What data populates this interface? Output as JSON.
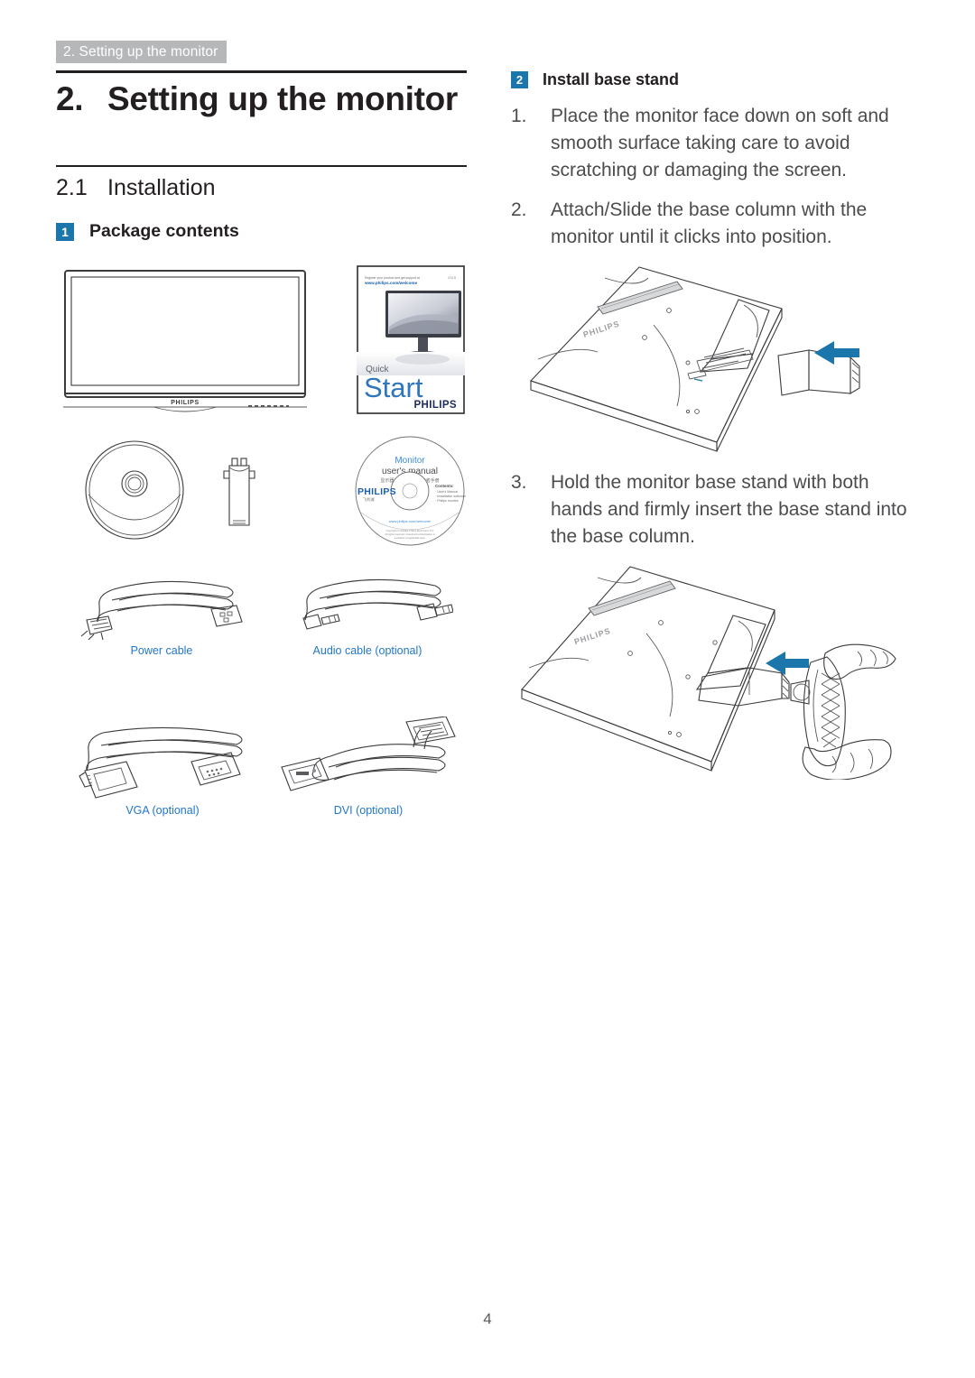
{
  "header": {
    "running_title": "2. Setting up the monitor",
    "tab_bg": "#b6b7b9"
  },
  "chapter": {
    "number": "2.",
    "title": "Setting up the monitor"
  },
  "section": {
    "number": "2.1",
    "title": "Installation"
  },
  "left_column": {
    "subsection": {
      "badge": "1",
      "label": "Package contents"
    },
    "items": [
      {
        "name": "monitor",
        "caption": ""
      },
      {
        "name": "quick-start-guide",
        "caption": ""
      },
      {
        "name": "base-disc",
        "caption": ""
      },
      {
        "name": "base-column",
        "caption": ""
      },
      {
        "name": "cd-rom",
        "caption": ""
      },
      {
        "name": "power-cable",
        "caption": "Power cable"
      },
      {
        "name": "audio-cable",
        "caption": "Audio cable (optional)"
      },
      {
        "name": "vga-cable",
        "caption": "VGA (optional)"
      },
      {
        "name": "dvi-cable",
        "caption": "DVI (optional)"
      }
    ],
    "monitor_logo": "PHILIPS",
    "quick_start": {
      "small_line_1": "Register your product and get support at",
      "small_line_2": "www.philips.com/welcome",
      "corner_code": "231S",
      "word_quick": "Quick",
      "word_start": "Start",
      "brand": "PHILIPS"
    },
    "cd": {
      "line_1": "Monitor",
      "line_2": "user's manual",
      "line_3": "显示器 用户手册 / 使用者手册",
      "brand": "PHILIPS",
      "brand_sub": "飞利浦",
      "contents_title": "Contents:",
      "contents": [
        "User's Manual",
        "Installation software",
        "Philips monitor"
      ],
      "url": "www.philips.com/welcome"
    },
    "caption_color": "#2277c8"
  },
  "right_column": {
    "subsection": {
      "badge": "2",
      "label": "Install base stand"
    },
    "steps": [
      {
        "number": "1.",
        "text": "Place the monitor face down on soft and smooth surface taking care to avoid scratching or damaging the screen."
      },
      {
        "number": "2.",
        "text": "Attach/Slide the base column with the monitor until it clicks into position."
      },
      {
        "number": "3.",
        "text": "Hold the monitor base stand with both hands and firmly insert the base stand into the base column."
      }
    ],
    "figures": [
      {
        "name": "figure-attach-base-column",
        "arrow": "left-arrow",
        "arrow_color": "#1b76ab",
        "back_logo": "PHILIPS"
      },
      {
        "name": "figure-insert-base-stand",
        "arrow": "left-arrow",
        "arrow_color": "#1b76ab",
        "back_logo": "PHILIPS"
      }
    ]
  },
  "footer": {
    "page_number": "4"
  },
  "colors": {
    "badge_blue": "#1b76ab",
    "caption_blue": "#2277c8",
    "body_text": "#4c4c4e",
    "heading_text": "#231f20",
    "rule": "#231f20"
  }
}
